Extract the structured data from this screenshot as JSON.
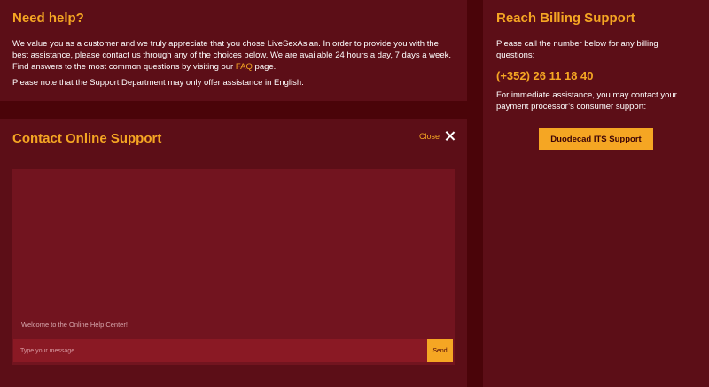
{
  "help": {
    "title": "Need help?",
    "paragraph1_before": "We value you as a customer and we truly appreciate that you chose LiveSexAsian. In order to provide you with the best assistance, please contact us through any of the choices below. We are available 24 hours a day, 7 days a week. Find answers to the most common questions by visiting our ",
    "faq_link": "FAQ",
    "paragraph1_after": " page.",
    "paragraph2": "Please note that the Support Department may only offer assistance in English."
  },
  "contact": {
    "title": "Contact Online Support",
    "close_label": "Close",
    "welcome": "Welcome to the Online Help Center!",
    "input_placeholder": "Type your message...",
    "send_label": "Send"
  },
  "billing": {
    "title": "Reach Billing Support",
    "intro": "Please call the number below for any billing questions:",
    "phone": "(+352) 26 11 18 40",
    "processor_text": "For immediate assistance, you may contact your payment processor’s consumer support:",
    "button_label": "Duodecad ITS Support"
  },
  "colors": {
    "background": "#4a0409",
    "panel": "#5c0e17",
    "accent": "#f5a623",
    "chat_area": "#72141f",
    "input": "#8a1924"
  },
  "icons": [
    "close-icon"
  ]
}
